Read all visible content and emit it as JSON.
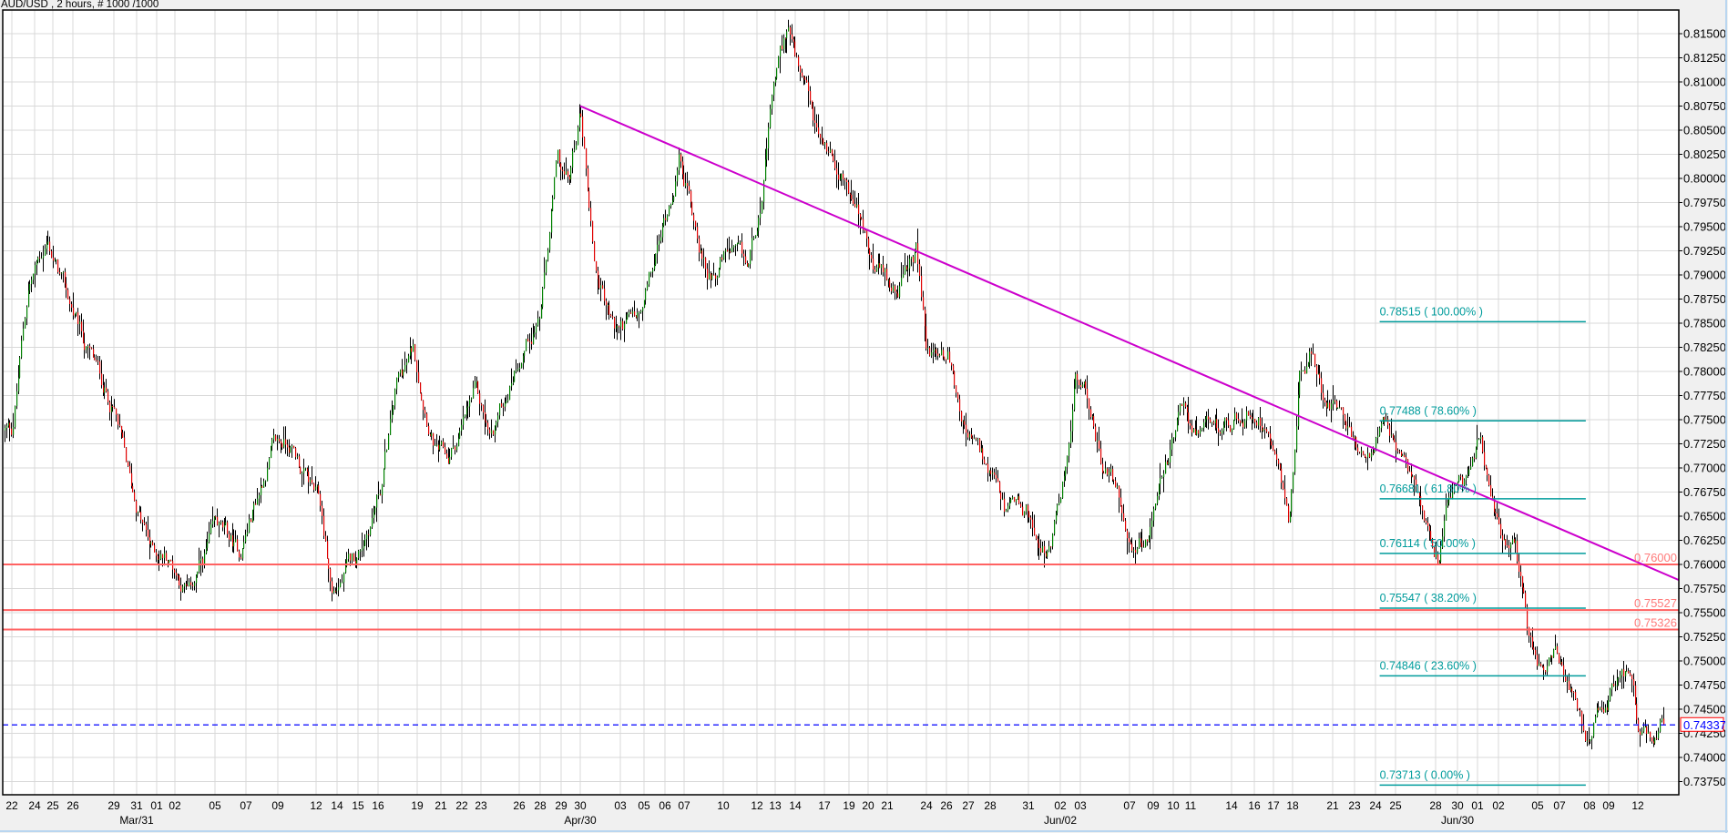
{
  "header": {
    "title": "AUD/USD , 2 hours, # 1000 /1000"
  },
  "chart_data": {
    "type": "candlestick",
    "symbol": "AUD/USD",
    "timeframe": "2 hours",
    "bars_shown": "1000 /1000",
    "grid": true,
    "colors": {
      "up": "#008000",
      "down": "#e00000",
      "wick": "#000000",
      "grid": "#d8d8d8",
      "trendline": "#cc00cc",
      "support": "#ff6262",
      "fib": "#009c9c",
      "current": "#0000ff"
    },
    "y_ticks": [
      "0.81500",
      "0.81250",
      "0.81000",
      "0.80750",
      "0.80500",
      "0.80250",
      "0.80000",
      "0.79750",
      "0.79500",
      "0.79250",
      "0.79000",
      "0.78750",
      "0.78500",
      "0.78250",
      "0.78000",
      "0.77750",
      "0.77500",
      "0.77250",
      "0.77000",
      "0.76750",
      "0.76500",
      "0.76250",
      "0.76000",
      "0.75750",
      "0.75500",
      "0.75250",
      "0.75000",
      "0.74750",
      "0.74500",
      "0.74250",
      "0.74000",
      "0.73750"
    ],
    "x_ticks": [
      {
        "label": "22",
        "date": "03-22"
      },
      {
        "label": "24",
        "date": "03-24"
      },
      {
        "label": "25",
        "date": "03-25"
      },
      {
        "label": "26",
        "date": "03-26"
      },
      {
        "label": "29",
        "date": "03-29"
      },
      {
        "label": "31",
        "date": "03-31"
      },
      {
        "label": "01",
        "date": "04-01"
      },
      {
        "label": "02",
        "date": "04-02"
      },
      {
        "label": "05",
        "date": "04-05"
      },
      {
        "label": "07",
        "date": "04-07"
      },
      {
        "label": "09",
        "date": "04-09"
      },
      {
        "label": "12",
        "date": "04-12"
      },
      {
        "label": "14",
        "date": "04-14"
      },
      {
        "label": "15",
        "date": "04-15"
      },
      {
        "label": "16",
        "date": "04-16"
      },
      {
        "label": "19",
        "date": "04-19"
      },
      {
        "label": "21",
        "date": "04-21"
      },
      {
        "label": "22",
        "date": "04-22"
      },
      {
        "label": "23",
        "date": "04-23"
      },
      {
        "label": "26",
        "date": "04-26"
      },
      {
        "label": "28",
        "date": "04-28"
      },
      {
        "label": "29",
        "date": "04-29"
      },
      {
        "label": "30",
        "date": "04-30"
      },
      {
        "label": "03",
        "date": "05-03"
      },
      {
        "label": "05",
        "date": "05-05"
      },
      {
        "label": "06",
        "date": "05-06"
      },
      {
        "label": "07",
        "date": "05-07"
      },
      {
        "label": "10",
        "date": "05-10"
      },
      {
        "label": "12",
        "date": "05-12"
      },
      {
        "label": "13",
        "date": "05-13"
      },
      {
        "label": "14",
        "date": "05-14"
      },
      {
        "label": "17",
        "date": "05-17"
      },
      {
        "label": "19",
        "date": "05-19"
      },
      {
        "label": "20",
        "date": "05-20"
      },
      {
        "label": "21",
        "date": "05-21"
      },
      {
        "label": "24",
        "date": "05-24"
      },
      {
        "label": "26",
        "date": "05-26"
      },
      {
        "label": "27",
        "date": "05-27"
      },
      {
        "label": "28",
        "date": "05-28"
      },
      {
        "label": "31",
        "date": "05-31"
      },
      {
        "label": "02",
        "date": "06-02"
      },
      {
        "label": "03",
        "date": "06-03"
      },
      {
        "label": "07",
        "date": "06-07"
      },
      {
        "label": "09",
        "date": "06-09"
      },
      {
        "label": "10",
        "date": "06-10"
      },
      {
        "label": "11",
        "date": "06-11"
      },
      {
        "label": "14",
        "date": "06-14"
      },
      {
        "label": "16",
        "date": "06-16"
      },
      {
        "label": "17",
        "date": "06-17"
      },
      {
        "label": "18",
        "date": "06-18"
      },
      {
        "label": "21",
        "date": "06-21"
      },
      {
        "label": "23",
        "date": "06-23"
      },
      {
        "label": "24",
        "date": "06-24"
      },
      {
        "label": "25",
        "date": "06-25"
      },
      {
        "label": "28",
        "date": "06-28"
      },
      {
        "label": "30",
        "date": "06-30"
      },
      {
        "label": "01",
        "date": "07-01"
      },
      {
        "label": "02",
        "date": "07-02"
      },
      {
        "label": "05",
        "date": "07-05"
      },
      {
        "label": "07",
        "date": "07-07"
      },
      {
        "label": "08",
        "date": "07-08"
      },
      {
        "label": "09",
        "date": "07-09"
      },
      {
        "label": "12",
        "date": "07-12"
      }
    ],
    "month_labels": [
      {
        "label": "Mar/31",
        "date": "03-31"
      },
      {
        "label": "Apr/30",
        "date": "04-30"
      },
      {
        "label": "Jun/02",
        "date": "06-02"
      },
      {
        "label": "Jun/30",
        "date": "06-30"
      }
    ],
    "price_path_approx": [
      [
        "03-22 00",
        0.7739
      ],
      [
        "03-23 10",
        0.7888
      ],
      [
        "03-24 16",
        0.7937
      ],
      [
        "03-25 16",
        0.7877
      ],
      [
        "03-26 18",
        0.783
      ],
      [
        "03-29 00",
        0.776
      ],
      [
        "03-30 09",
        0.768
      ],
      [
        "03-31 17",
        0.7614
      ],
      [
        "04-01 13",
        0.761
      ],
      [
        "04-03 01",
        0.757
      ],
      [
        "04-05 01",
        0.7637
      ],
      [
        "04-06 13",
        0.761
      ],
      [
        "04-08 13",
        0.7717
      ],
      [
        "04-09 20",
        0.7728
      ],
      [
        "04-12 08",
        0.766
      ],
      [
        "04-13 12",
        0.7568
      ],
      [
        "04-15 00",
        0.761
      ],
      [
        "04-16 04",
        0.768
      ],
      [
        "04-17 10",
        0.7785
      ],
      [
        "04-18 16",
        0.782
      ],
      [
        "04-20 14",
        0.7717
      ],
      [
        "04-21 08",
        0.7705
      ],
      [
        "04-22 16",
        0.7774
      ],
      [
        "04-23 18",
        0.7728
      ],
      [
        "04-25 23",
        0.782
      ],
      [
        "04-28 01",
        0.7865
      ],
      [
        "04-28 19",
        0.8014
      ],
      [
        "04-29 09",
        0.7991
      ],
      [
        "04-30 00",
        0.8071
      ],
      [
        "05-01 02",
        0.791
      ],
      [
        "05-02 13",
        0.7842
      ],
      [
        "05-04 18",
        0.7854
      ],
      [
        "05-06 00",
        0.7957
      ],
      [
        "05-06 18",
        0.8025
      ],
      [
        "05-07 10",
        0.798
      ],
      [
        "05-08 17",
        0.79
      ],
      [
        "05-10 07",
        0.7922
      ],
      [
        "05-11 10",
        0.79
      ],
      [
        "05-12 07",
        0.7991
      ],
      [
        "05-12 22",
        0.8094
      ],
      [
        "05-13 15",
        0.8157
      ],
      [
        "05-14 14",
        0.8094
      ],
      [
        "05-16 07",
        0.8037
      ],
      [
        "05-18 06",
        0.8014
      ],
      [
        "05-19 14",
        0.7957
      ],
      [
        "05-20 03",
        0.791
      ],
      [
        "05-21 04",
        0.7888
      ],
      [
        "05-22 09",
        0.79
      ],
      [
        "05-23 05",
        0.7922
      ],
      [
        "05-24 00",
        0.782
      ],
      [
        "05-26 01",
        0.782
      ],
      [
        "05-26 21",
        0.774
      ],
      [
        "05-27 16",
        0.7705
      ],
      [
        "05-29 02",
        0.765
      ],
      [
        "05-30 18",
        0.765
      ],
      [
        "06-01 09",
        0.761
      ],
      [
        "06-02 07",
        0.7705
      ],
      [
        "06-02 18",
        0.7797
      ],
      [
        "06-03 20",
        0.776
      ],
      [
        "06-04 18",
        0.7705
      ],
      [
        "06-06 04",
        0.767
      ],
      [
        "06-07 03",
        0.7614
      ],
      [
        "06-08 19",
        0.7637
      ],
      [
        "06-09 14",
        0.7705
      ],
      [
        "06-10 15",
        0.776
      ],
      [
        "06-11 17",
        0.7728
      ],
      [
        "06-13 10",
        0.774
      ],
      [
        "06-16 03",
        0.776
      ],
      [
        "06-17 06",
        0.7728
      ],
      [
        "06-17 19",
        0.765
      ],
      [
        "06-18 12",
        0.7797
      ],
      [
        "06-19 09",
        0.782
      ],
      [
        "06-20 05",
        0.7774
      ],
      [
        "06-21 14",
        0.7774
      ],
      [
        "06-23 07",
        0.7705
      ],
      [
        "06-24 08",
        0.774
      ],
      [
        "06-25 06",
        0.7705
      ],
      [
        "06-26 23",
        0.767
      ],
      [
        "06-28 06",
        0.7614
      ],
      [
        "06-29 04",
        0.768
      ],
      [
        "06-30 08",
        0.768
      ],
      [
        "07-01 02",
        0.7728
      ],
      [
        "07-01 15",
        0.767
      ],
      [
        "07-02 07",
        0.7614
      ],
      [
        "07-03 05",
        0.7625
      ],
      [
        "07-04 04",
        0.7534
      ],
      [
        "07-05 02",
        0.75
      ],
      [
        "07-06 12",
        0.751
      ],
      [
        "07-07 05",
        0.7477
      ],
      [
        "07-07 14",
        0.7442
      ],
      [
        "07-08 00",
        0.7396
      ],
      [
        "07-08 06",
        0.743
      ],
      [
        "07-09 02",
        0.7465
      ],
      [
        "07-10 20",
        0.7477
      ],
      [
        "07-12 00",
        0.743
      ],
      [
        "07-13 17",
        0.7408
      ],
      [
        "07-14 14",
        0.74337
      ]
    ],
    "trendline": {
      "start": {
        "t": "04-30 00",
        "p": 0.8075
      },
      "through": {
        "t": "07-12 12",
        "p": 0.76
      }
    },
    "horizontal_lines": [
      {
        "price": 0.76,
        "label": "0.76000"
      },
      {
        "price": 0.75527,
        "label": "0.75527"
      },
      {
        "price": 0.75326,
        "label": "0.75326"
      }
    ],
    "current_price": {
      "price": 0.74337,
      "label": "0.74337"
    },
    "fibonacci": {
      "from": "06-24 05",
      "to": "07-07 21",
      "levels": [
        {
          "price": 0.78515,
          "label": "0.78515 ( 100.00% )"
        },
        {
          "price": 0.77488,
          "label": "0.77488 ( 78.60% )"
        },
        {
          "price": 0.76681,
          "label": "0.76681 ( 61.80% )"
        },
        {
          "price": 0.76114,
          "label": "0.76114 ( 50.00% )"
        },
        {
          "price": 0.75547,
          "label": "0.75547 ( 38.20% )"
        },
        {
          "price": 0.74846,
          "label": "0.74846 ( 23.60% )"
        },
        {
          "price": 0.73713,
          "label": "0.73713 ( 0.00% )"
        }
      ]
    }
  }
}
